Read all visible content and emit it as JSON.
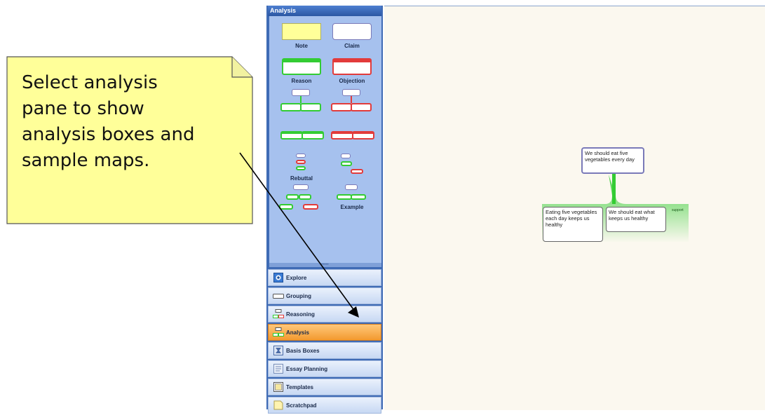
{
  "callout": {
    "lines": [
      "Select analysis",
      "pane to show",
      "analysis boxes and",
      "sample maps."
    ]
  },
  "panel": {
    "title": "Analysis",
    "palette": {
      "note": "Note",
      "claim": "Claim",
      "reason": "Reason",
      "objection": "Objection",
      "rebuttal": "Rebuttal",
      "example": "Example"
    },
    "nav": [
      {
        "label": "Explore",
        "icon": "explore-icon"
      },
      {
        "label": "Grouping",
        "icon": "grouping-icon"
      },
      {
        "label": "Reasoning",
        "icon": "reasoning-icon"
      },
      {
        "label": "Analysis",
        "icon": "analysis-icon"
      },
      {
        "label": "Basis Boxes",
        "icon": "basis-boxes-icon"
      },
      {
        "label": "Essay Planning",
        "icon": "essay-planning-icon"
      },
      {
        "label": "Templates",
        "icon": "templates-icon"
      },
      {
        "label": "Scratchpad",
        "icon": "scratchpad-icon"
      }
    ]
  },
  "map": {
    "claim": "We should eat five vegetables every day",
    "reason_left": "Eating five vegetables each day keeps us healthy",
    "reason_right": "We should eat what keeps us healthy",
    "support_label": "support"
  },
  "colors": {
    "panel": "#3f6bb5",
    "palette_bg": "#a6c1ee",
    "active_nav": "#f39a2f",
    "note_yellow": "#ffff99",
    "reason_green": "#33cc33",
    "objection_red": "#e23b3b",
    "claim_border": "#7a7ab8",
    "canvas": "#fbf8ef"
  }
}
